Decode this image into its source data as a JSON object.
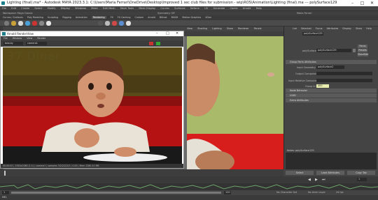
{
  "app": {
    "title": "Lighting (final).ma* - Autodesk MAYA 2023.3.1: C:\\Users\\Maria Ferrari\\OneDrive\\Desktop\\Improved 1 sec club files for submission - wip\\ROS\\Animation\\Lighting (final).ma  ---  polySurface129",
    "window_buttons": [
      "–",
      "□",
      "✕"
    ]
  },
  "menubar": [
    "File",
    "Edit",
    "Create",
    "Select",
    "Modify",
    "Display",
    "Windows",
    "Mesh",
    "Edit Mesh",
    "Mesh Tools",
    "Mesh Display",
    "Curves",
    "Surfaces",
    "Deform",
    "UV",
    "Generate",
    "Cache",
    "Arnold",
    "Help"
  ],
  "statusline": {
    "workspace": "Workspace: Maya Classic",
    "symmetry": "Symmetry: Off",
    "user": "Maria Ferrari"
  },
  "shelf_tabs": [
    "Curves / Surfaces",
    "Poly Modeling",
    "Sculpting",
    "Rigging",
    "Animation",
    "Rendering",
    "FX",
    "FX Caching",
    "Custom",
    "Arnold",
    "Bifrost",
    "MASH",
    "Motion Graphics",
    "XGen"
  ],
  "shelf_active": "Rendering",
  "viewport_menu": [
    "View",
    "Shading",
    "Lighting",
    "Show",
    "Renderer",
    "Panels"
  ],
  "render_window": {
    "title": "Arnold RenderView",
    "menu": [
      "File",
      "Window",
      "View",
      "Render"
    ],
    "camera": "camera1",
    "aov": "beauty",
    "sign_text": "37 Diner",
    "status": "00:00:02 | 1920x1080 (1:1) | camera1 | samples 3/2/2/2/2/2 | 0.00 | Mem 2280.41 MB"
  },
  "attribute_editor": {
    "menu": [
      "List",
      "Selected",
      "Focus",
      "Attributes",
      "Display",
      "Show",
      "Help"
    ],
    "tab": "polySurface129",
    "node_label": "polySurface:",
    "node_value": "polySurface129",
    "focus_btn": "Focus",
    "presets_btn": "Presets",
    "show_btn": "Show",
    "hide_btn": "Hide",
    "section_open": "Group Parts Attributes",
    "rows": [
      {
        "label": "Input Geometry",
        "value": "polySurface2"
      },
      {
        "label": "Output Components",
        "value": ""
      },
      {
        "label": "Input Relative Components",
        "value": ""
      },
      {
        "label": "Group Id",
        "value": "400"
      }
    ],
    "sections_closed": [
      "Node Behavior",
      "UUID",
      "Extra Attributes"
    ],
    "notes": "Notes: polySurface129",
    "buttons": [
      "Select",
      "Load Attributes",
      "Copy Tab"
    ]
  },
  "timeline": {
    "current_frame": "1",
    "start": "1",
    "end": "120",
    "no_character_set": "No Character Set",
    "no_anim_layer": "No Anim Layer",
    "fps": "24 fps"
  },
  "command_line": "MEL"
}
